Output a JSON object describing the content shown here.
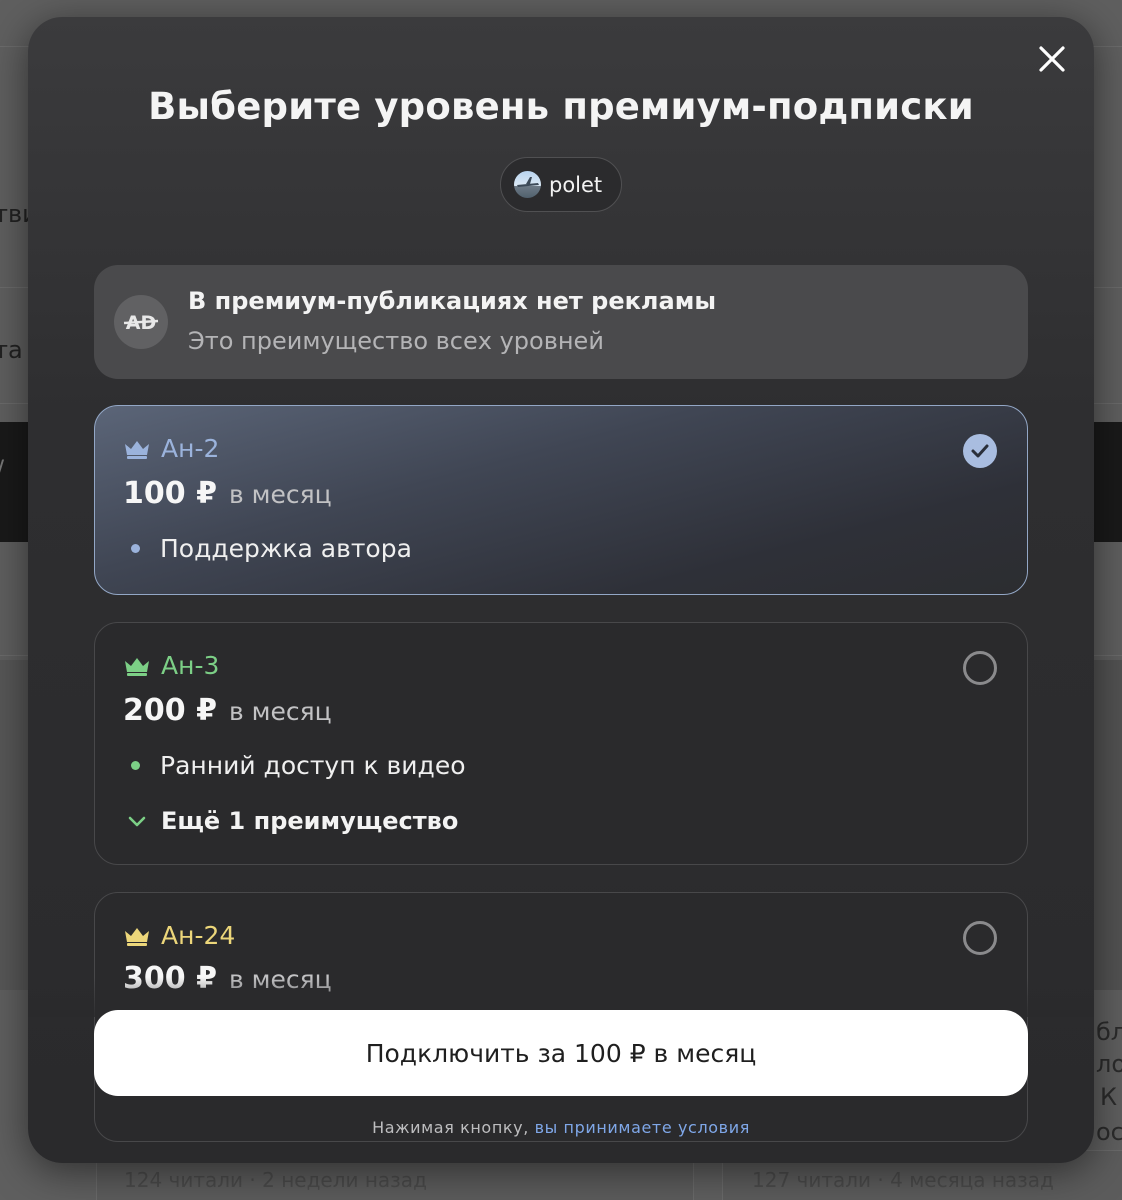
{
  "background": {
    "fragments": [
      "тви",
      "та",
      "/",
      "бли",
      "ло",
      "К",
      "ос"
    ],
    "card_meta_left": "124 читали · 2 недели назад",
    "card_meta_right": "127 читали · 4 месяца назад"
  },
  "modal": {
    "title": "Выберите уровень премиум-подписки",
    "close_icon": "close-icon",
    "channel": {
      "name": "polet",
      "avatar_icon": "airplane-avatar"
    },
    "info": {
      "icon": "no-ads-icon",
      "badge_text": "AD",
      "title": "В премиум-публикациях нет рекламы",
      "subtitle": "Это преимущество всех уровней"
    },
    "tiers": [
      {
        "name": "Ан-2",
        "price": "100 ₽",
        "period": "в месяц",
        "color": "#9bb3dc",
        "selected": true,
        "benefits": [
          "Поддержка автора"
        ]
      },
      {
        "name": "Ан-3",
        "price": "200 ₽",
        "period": "в месяц",
        "color": "#7ccf86",
        "selected": false,
        "benefits": [
          "Ранний доступ к видео"
        ],
        "more": "Ещё 1 преимущество"
      },
      {
        "name": "Ан-24",
        "price": "300 ₽",
        "period": "в месяц",
        "color": "#ecd67a",
        "selected": false,
        "benefits": []
      }
    ],
    "cta": "Подключить за 100 ₽ в месяц",
    "terms_prefix": "Нажимая кнопку, ",
    "terms_link": "вы принимаете условия"
  }
}
